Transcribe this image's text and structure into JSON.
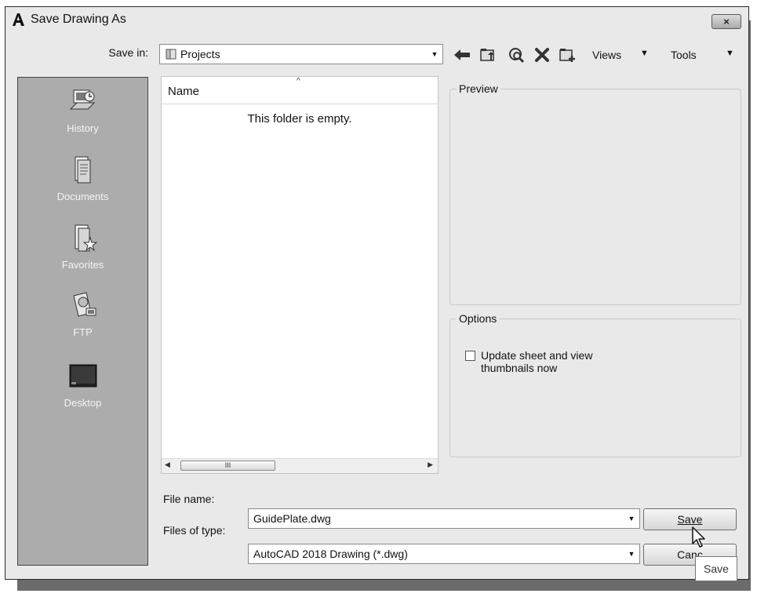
{
  "window": {
    "title": "Save Drawing As",
    "close_label": "×"
  },
  "toolbar": {
    "save_in_label": "Save in:",
    "save_in_value": "Projects",
    "views_label": "Views",
    "tools_label": "Tools",
    "icons": [
      "back-icon",
      "up-folder-icon",
      "search-web-icon",
      "delete-icon",
      "new-folder-icon"
    ]
  },
  "places": [
    {
      "label": "History",
      "icon": "history-icon"
    },
    {
      "label": "Documents",
      "icon": "documents-icon"
    },
    {
      "label": "Favorites",
      "icon": "favorites-icon"
    },
    {
      "label": "FTP",
      "icon": "ftp-icon"
    },
    {
      "label": "Desktop",
      "icon": "desktop-icon"
    }
  ],
  "file_list": {
    "column_name": "Name",
    "empty_text": "This folder is empty.",
    "scroll_thumb": "III"
  },
  "preview": {
    "title": "Preview"
  },
  "options": {
    "title": "Options",
    "checkbox_label_line1": "Update sheet and view",
    "checkbox_label_line2": "thumbnails now",
    "checked": false
  },
  "file_name": {
    "label": "File name:",
    "value": "GuidePlate.dwg"
  },
  "file_type": {
    "label": "Files of type:",
    "value": "AutoCAD 2018 Drawing (*.dwg)"
  },
  "buttons": {
    "save": "Save",
    "cancel": "Canc"
  },
  "tooltip": {
    "text": "Save"
  }
}
